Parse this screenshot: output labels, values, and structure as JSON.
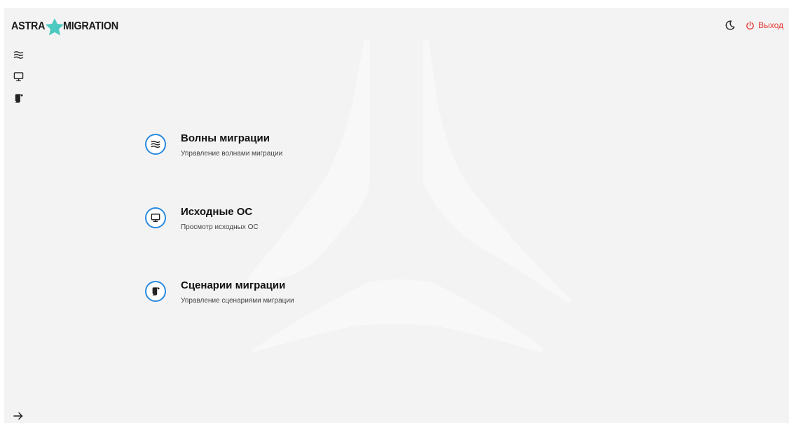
{
  "header": {
    "brand_left": "ASTRA",
    "brand_right": "MIGRATION",
    "logout_label": "Выход",
    "theme_icon": "moon-icon",
    "logout_icon": "power-icon"
  },
  "sidebar": {
    "items": [
      {
        "icon": "waves-icon"
      },
      {
        "icon": "monitor-icon"
      },
      {
        "icon": "scroll-icon"
      }
    ],
    "expand_icon": "arrow-right-icon"
  },
  "menu": {
    "items": [
      {
        "title": "Волны миграции",
        "description": "Управление волнами миграции",
        "icon": "waves-icon"
      },
      {
        "title": "Исходные ОС",
        "description": "Просмотр исходных ОС",
        "icon": "monitor-icon"
      },
      {
        "title": "Сценарии миграции",
        "description": "Управление сценариями миграции",
        "icon": "scroll-icon"
      }
    ]
  },
  "colors": {
    "accent": "#2a8ae0",
    "logout": "#e53935",
    "star": "#4cc9c0",
    "background": "#f3f3f3"
  }
}
